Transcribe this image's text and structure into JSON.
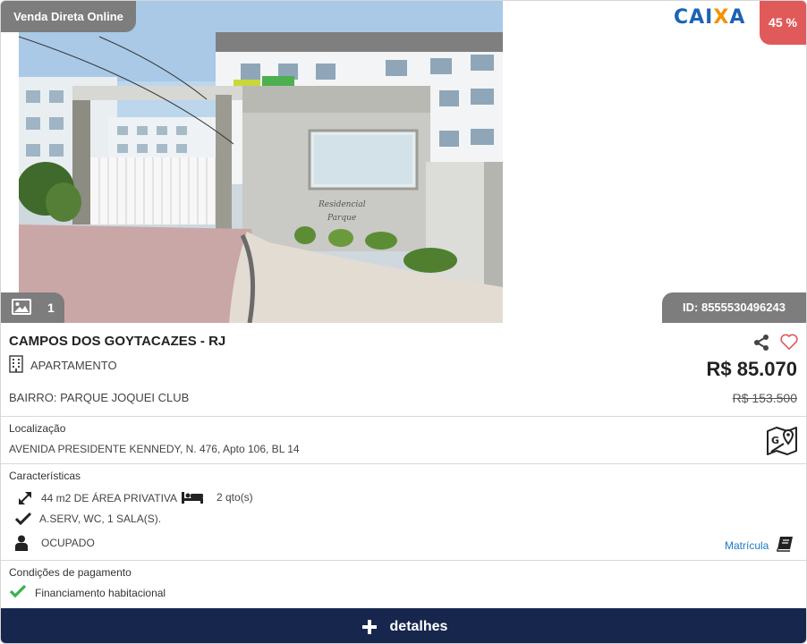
{
  "badges": {
    "sale_type": "Venda Direta Online",
    "discount": "45 %",
    "photo_count": "1",
    "id": "ID: 8555530496243"
  },
  "brand": {
    "logo_part1": "CAI",
    "logo_x": "X",
    "logo_part2": "A"
  },
  "property": {
    "city": "CAMPOS DOS GOYTACAZES - RJ",
    "type": "APARTAMENTO",
    "neighborhood": "BAIRRO: PARQUE JOQUEI CLUB",
    "price": "R$ 85.070",
    "old_price": "R$ 153.500"
  },
  "location": {
    "title": "Localização",
    "address": "AVENIDA PRESIDENTE KENNEDY, N. 476, Apto 106, BL 14"
  },
  "features": {
    "title": "Características",
    "area": "44 m2 DE ÁREA PRIVATIVA",
    "rooms": "2 qto(s)",
    "extras": "A.SERV, WC, 1 SALA(S).",
    "status": "OCUPADO",
    "matricula": "Matrícula"
  },
  "payment": {
    "title": "Condições de pagamento",
    "option": "Financiamento habitacional"
  },
  "actions": {
    "details": "detalhes"
  },
  "colors": {
    "brand_blue": "#1b63b7",
    "brand_orange": "#f39200",
    "discount_red": "#e05a5a",
    "badge_gray": "#7d7d7d",
    "button_navy": "#17264d",
    "check_green": "#3bb04a",
    "heart_red": "#e05a5a"
  }
}
